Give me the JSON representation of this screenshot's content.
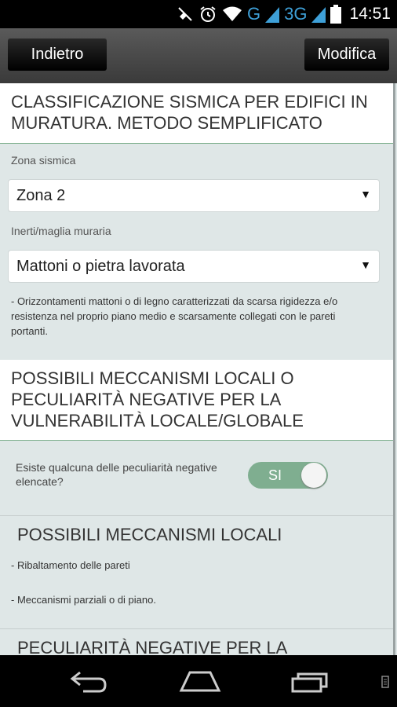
{
  "status_bar": {
    "network_g": "G",
    "network_3g": "3G",
    "time": "14:51",
    "icons": [
      "mute-icon",
      "alarm-icon",
      "wifi-icon",
      "signal-icon",
      "signal-icon",
      "battery-icon"
    ]
  },
  "action_bar": {
    "back_label": "Indietro",
    "edit_label": "Modifica"
  },
  "section1": {
    "title": "CLASSIFICAZIONE SISMICA PER EDIFICI IN MURATURA. METODO SEMPLIFICATO"
  },
  "zona": {
    "label": "Zona sismica",
    "value": "Zona 2"
  },
  "inerti": {
    "label": "Inerti/maglia muraria",
    "value": "Mattoni o pietra lavorata"
  },
  "note": "- Orizzontamenti mattoni o di legno caratterizzati da scarsa rigidezza e/o resistenza nel proprio piano medio e scarsamente collegati con le pareti portanti.",
  "section2": {
    "title": "POSSIBILI MECCANISMI LOCALI O PECULIARITÀ NEGATIVE PER LA VULNERABILITÀ LOCALE/GLOBALE"
  },
  "toggle": {
    "question": "Esiste qualcuna delle peculiarità negative elencate?",
    "state_label": "SI"
  },
  "local_mechanisms": {
    "title": "POSSIBILI MECCANISMI LOCALI",
    "items": [
      "- Ribaltamento delle pareti",
      "- Meccanismi parziali o di piano."
    ]
  },
  "next_section_title": "PECULIARITÀ NEGATIVE PER LA",
  "colors": {
    "accent": "#7fae90",
    "background": "#dfe7e7"
  }
}
